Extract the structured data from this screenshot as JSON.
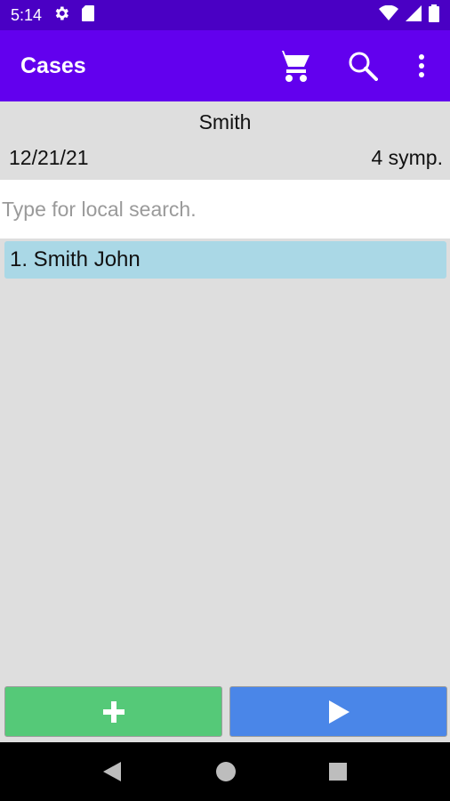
{
  "status_bar": {
    "time": "5:14",
    "icons": [
      "gear-icon",
      "sd-card-icon",
      "wifi-icon",
      "signal-icon",
      "battery-icon"
    ]
  },
  "app_bar": {
    "title": "Cases",
    "actions": [
      "cart-icon",
      "search-icon",
      "more-vert-icon"
    ]
  },
  "header": {
    "name": "Smith",
    "date": "12/21/21",
    "symptoms": "4 symp."
  },
  "search": {
    "placeholder": "Type for local search."
  },
  "cases": [
    {
      "label": "1. Smith John"
    }
  ],
  "buttons": {
    "add_icon": "plus-icon",
    "play_icon": "play-icon"
  },
  "nav_bar": {
    "icons": [
      "back-icon",
      "home-icon",
      "recents-icon"
    ]
  },
  "colors": {
    "status_bar": "#4a00c4",
    "app_bar": "#6200ee",
    "selected_item": "#aad8e6",
    "add_button": "#55c978",
    "play_button": "#4a86e8"
  }
}
